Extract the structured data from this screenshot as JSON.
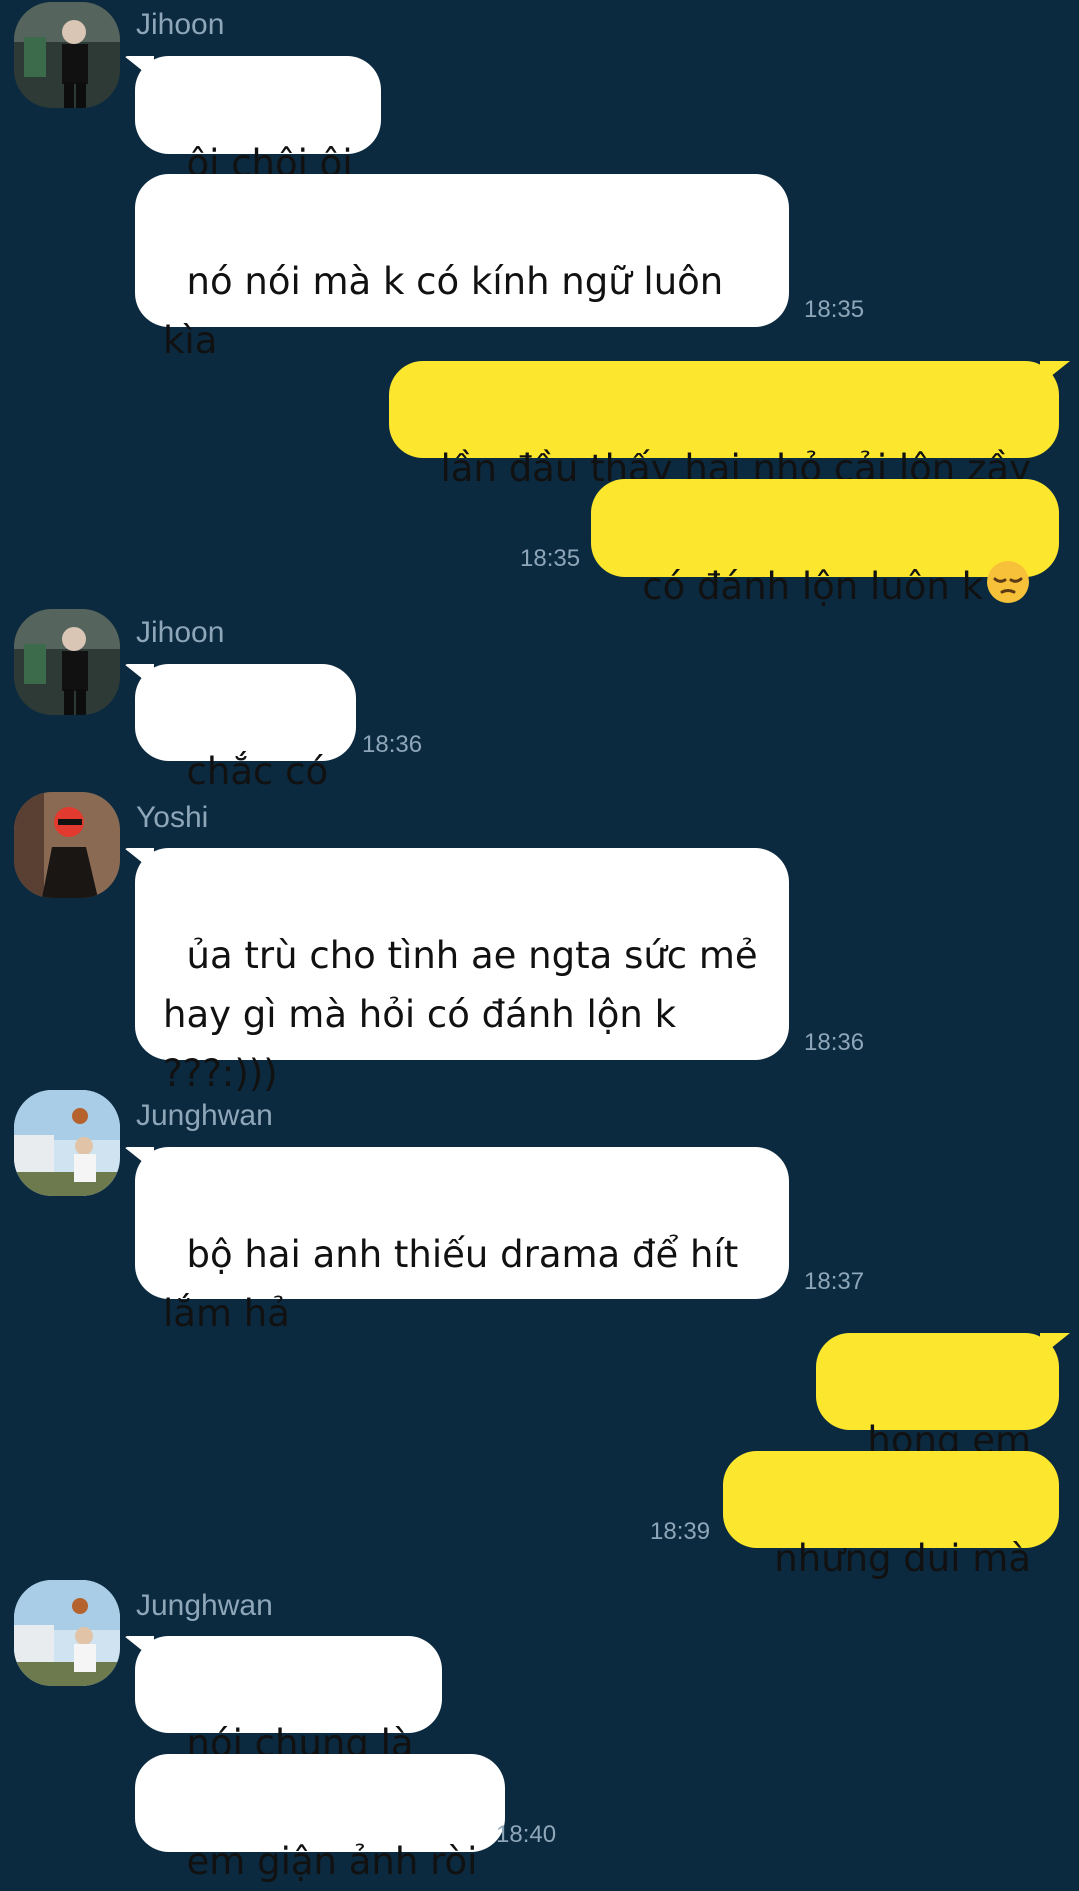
{
  "messages": [
    {
      "sender": "Jihoon",
      "text": "ôi chội ôi"
    },
    {
      "text": "nó nói mà k có kính ngữ luôn kìa",
      "time": "18:35"
    },
    {
      "text": "lần đầu thấy hai nhỏ cải lộn zầy"
    },
    {
      "text": "có đánh lộn luôn k",
      "emoji": "pensive-face-emoji",
      "time": "18:35"
    },
    {
      "sender": "Jihoon",
      "text": "chắc có",
      "time": "18:36"
    },
    {
      "sender": "Yoshi",
      "text": "ủa trù cho tình ae ngta sức mẻ hay gì mà hỏi có đánh lộn k ???:)))",
      "time": "18:36"
    },
    {
      "sender": "Junghwan",
      "text": "bộ hai anh thiếu drama để hít lắm hả",
      "time": "18:37"
    },
    {
      "text": "hong em"
    },
    {
      "text": "nhưng dui mà",
      "time": "18:39"
    },
    {
      "sender": "Junghwan",
      "text": "nói chung là"
    },
    {
      "text": "em giận ảnh ròi",
      "time": "18:40"
    }
  ],
  "colors": {
    "background": "#0b2a3f",
    "incoming_bubble": "#ffffff",
    "outgoing_bubble": "#fde72e",
    "meta_text": "#8ea6b8"
  }
}
